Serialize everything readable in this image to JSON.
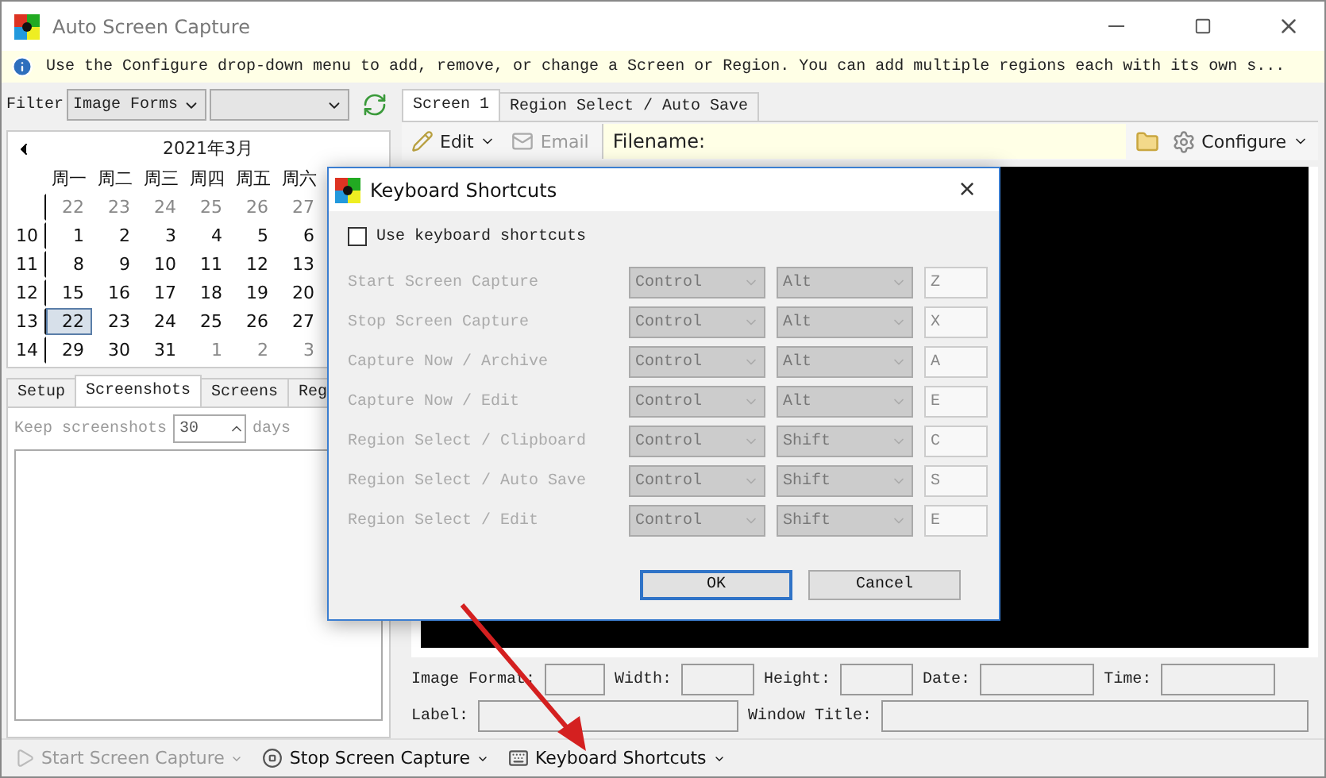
{
  "window": {
    "title": "Auto Screen Capture"
  },
  "info_bar": {
    "text": "Use the Configure drop-down menu to add, remove, or change a Screen or Region. You can add multiple regions each with its own s..."
  },
  "filter": {
    "label": "Filter",
    "type_value": "Image Forms"
  },
  "calendar": {
    "month": "2021年3月",
    "weekdays": [
      "周一",
      "周二",
      "周三",
      "周四",
      "周五",
      "周六"
    ],
    "weeks": [
      {
        "days": [
          {
            "day": "22",
            "other_month": true,
            "selected": false
          },
          {
            "day": "23",
            "other_month": true,
            "selected": false
          },
          {
            "day": "24",
            "other_month": true,
            "selected": false
          },
          {
            "day": "25",
            "other_month": true,
            "selected": false
          },
          {
            "day": "26",
            "other_month": true,
            "selected": false
          },
          {
            "day": "27",
            "other_month": true,
            "selected": false
          }
        ]
      },
      {
        "number": "10",
        "days": [
          {
            "day": "1",
            "other_month": false,
            "selected": false
          },
          {
            "day": "2",
            "other_month": false,
            "selected": false
          },
          {
            "day": "3",
            "other_month": false,
            "selected": false
          },
          {
            "day": "4",
            "other_month": false,
            "selected": false
          },
          {
            "day": "5",
            "other_month": false,
            "selected": false
          },
          {
            "day": "6",
            "other_month": false,
            "selected": false
          }
        ]
      },
      {
        "number": "11",
        "days": [
          {
            "day": "8",
            "other_month": false,
            "selected": false
          },
          {
            "day": "9",
            "other_month": false,
            "selected": false
          },
          {
            "day": "10",
            "other_month": false,
            "selected": false
          },
          {
            "day": "11",
            "other_month": false,
            "selected": false
          },
          {
            "day": "12",
            "other_month": false,
            "selected": false
          },
          {
            "day": "13",
            "other_month": false,
            "selected": false
          }
        ]
      },
      {
        "number": "12",
        "days": [
          {
            "day": "15",
            "other_month": false,
            "selected": false
          },
          {
            "day": "16",
            "other_month": false,
            "selected": false
          },
          {
            "day": "17",
            "other_month": false,
            "selected": false
          },
          {
            "day": "18",
            "other_month": false,
            "selected": false
          },
          {
            "day": "19",
            "other_month": false,
            "selected": false
          },
          {
            "day": "20",
            "other_month": false,
            "selected": false
          }
        ]
      },
      {
        "number": "13",
        "days": [
          {
            "day": "22",
            "other_month": false,
            "selected": true
          },
          {
            "day": "23",
            "other_month": false,
            "selected": false
          },
          {
            "day": "24",
            "other_month": false,
            "selected": false
          },
          {
            "day": "25",
            "other_month": false,
            "selected": false
          },
          {
            "day": "26",
            "other_month": false,
            "selected": false
          },
          {
            "day": "27",
            "other_month": false,
            "selected": false
          }
        ]
      },
      {
        "number": "14",
        "days": [
          {
            "day": "29",
            "other_month": false,
            "selected": false
          },
          {
            "day": "30",
            "other_month": false,
            "selected": false
          },
          {
            "day": "31",
            "other_month": false,
            "selected": false
          },
          {
            "day": "1",
            "other_month": true,
            "selected": false
          },
          {
            "day": "2",
            "other_month": true,
            "selected": false
          },
          {
            "day": "3",
            "other_month": true,
            "selected": false
          }
        ]
      }
    ]
  },
  "left_tabs": [
    {
      "label": "Setup",
      "selected": false
    },
    {
      "label": "Screenshots",
      "selected": true
    },
    {
      "label": "Screens",
      "selected": false
    },
    {
      "label": "Reg",
      "selected": false
    }
  ],
  "keep": {
    "label": "Keep screenshots",
    "value": "30",
    "unit": "days"
  },
  "right_tabs": [
    {
      "label": "Screen 1",
      "selected": true
    },
    {
      "label": "Region Select / Auto Save",
      "selected": false
    }
  ],
  "toolbar": {
    "edit": "Edit",
    "email": "Email",
    "email_disabled": true,
    "filename_label": "Filename:",
    "configure": "Configure"
  },
  "details": {
    "row_1": [
      "Image Format:",
      "Width:",
      "Height:",
      "Date:",
      "Time:"
    ],
    "row_2": [
      "Label:",
      "Window Title:"
    ]
  },
  "status_bar": [
    {
      "label": "Start Screen Capture",
      "disabled": true
    },
    {
      "label": "Stop Screen Capture",
      "disabled": false
    },
    {
      "label": "Keyboard Shortcuts",
      "disabled": false
    }
  ],
  "dialog": {
    "title": "Keyboard Shortcuts",
    "close": "×",
    "use_shortcuts": {
      "label": "Use keyboard shortcuts",
      "checked": false
    },
    "shortcuts": [
      {
        "label": "Start Screen Capture",
        "modifier_1": "Control",
        "modifier_2": "Alt",
        "key": "Z",
        "disabled": true
      },
      {
        "label": "Stop Screen Capture",
        "modifier_1": "Control",
        "modifier_2": "Alt",
        "key": "X",
        "disabled": true
      },
      {
        "label": "Capture Now / Archive",
        "modifier_1": "Control",
        "modifier_2": "Alt",
        "key": "A",
        "disabled": true
      },
      {
        "label": "Capture Now / Edit",
        "modifier_1": "Control",
        "modifier_2": "Alt",
        "key": "E",
        "disabled": true
      },
      {
        "label": "Region Select / Clipboard",
        "modifier_1": "Control",
        "modifier_2": "Shift",
        "key": "C",
        "disabled": true
      },
      {
        "label": "Region Select / Auto Save",
        "modifier_1": "Control",
        "modifier_2": "Shift",
        "key": "S",
        "disabled": true
      },
      {
        "label": "Region Select / Edit",
        "modifier_1": "Control",
        "modifier_2": "Shift",
        "key": "E",
        "disabled": true
      }
    ],
    "buttons": [
      {
        "label": "OK",
        "default": true
      },
      {
        "label": "Cancel",
        "default": false
      }
    ]
  }
}
